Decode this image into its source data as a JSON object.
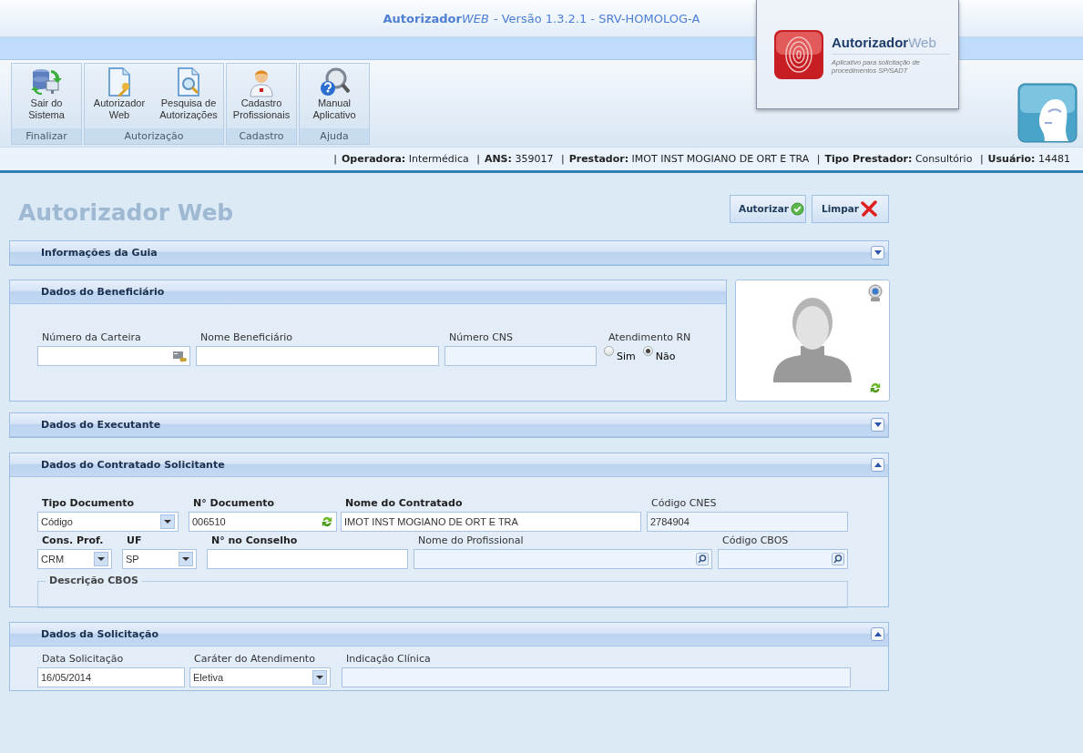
{
  "app_title": {
    "name": "Autorizador",
    "edition": "WEB",
    "version": "- Versão 1.3.2.1 - SRV-HOMOLOG-A"
  },
  "toolbar": [
    {
      "group": "Finalizar",
      "buttons": [
        {
          "label": "Sair do Sistema"
        }
      ]
    },
    {
      "group": "Autorização",
      "buttons": [
        {
          "label": "Autorizador Web"
        },
        {
          "label": "Pesquisa de Autorizações"
        }
      ]
    },
    {
      "group": "Cadastro",
      "buttons": [
        {
          "label": "Cadastro Profissionais"
        }
      ]
    },
    {
      "group": "Ajuda",
      "buttons": [
        {
          "label": "Manual Aplicativo"
        }
      ]
    }
  ],
  "splash": {
    "name": "Autorizador",
    "edition": "Web",
    "tagline": "Aplicativo para solicitação de procedimentos SP/SADT"
  },
  "info_bar": {
    "separator": "|",
    "items": [
      {
        "label": "Operadora:",
        "value": "Intermédica"
      },
      {
        "label": "ANS:",
        "value": "359017"
      },
      {
        "label": "Prestador:",
        "value": "IMOT INST MOGIANO DE ORT E TRA"
      },
      {
        "label": "Tipo Prestador:",
        "value": "Consultório"
      },
      {
        "label": "Usuário:",
        "value": "14481"
      }
    ]
  },
  "page_title": "Autorizador Web",
  "actions": [
    {
      "label": "Autorizar"
    },
    {
      "label": "Limpar"
    }
  ],
  "sections": [
    {
      "title": "Informações da Guia",
      "collapsible": true,
      "expanded": false
    },
    {
      "title": "Dados do Beneficiário",
      "collapsible": false,
      "photo_panel": true,
      "fields": [
        {
          "label": "Número da Carteira",
          "kind": "cardsearch",
          "disabled": false
        },
        {
          "label": "Nome Beneficiário",
          "kind": "text",
          "disabled": false
        },
        {
          "label": "Número CNS",
          "kind": "text",
          "disabled": true
        },
        {
          "label": "Atendimento RN",
          "kind": "radio",
          "options": [
            {
              "label": "Sim",
              "selected": false
            },
            {
              "label": "Não",
              "selected": true
            }
          ]
        }
      ]
    },
    {
      "title": "Dados do Executante",
      "collapsible": true,
      "expanded": false
    },
    {
      "title": "Dados do Contratado Solicitante",
      "collapsible": true,
      "expanded": true,
      "fields": [
        {
          "label": "Tipo Documento",
          "kind": "select",
          "value": "Código",
          "disabled": false,
          "bold_label": true
        },
        {
          "label": "N° Documento",
          "kind": "refresh",
          "value": "006510",
          "disabled": false,
          "bold_label": true
        },
        {
          "label": "Nome do Contratado",
          "kind": "text",
          "value": "IMOT INST MOGIANO DE ORT E TRA",
          "disabled": false,
          "bold_label": true
        },
        {
          "label": "Código CNES",
          "kind": "text",
          "value": "2784904",
          "disabled": true,
          "bold_label": false
        },
        {
          "label": "Cons. Prof.",
          "kind": "select",
          "value": "CRM",
          "disabled": false,
          "bold_label": true
        },
        {
          "label": "UF",
          "kind": "select",
          "value": "SP",
          "disabled": false,
          "bold_label": true
        },
        {
          "label": "N° no Conselho",
          "kind": "text",
          "disabled": false,
          "bold_label": true
        },
        {
          "label": "Nome do Profissional",
          "kind": "search",
          "disabled": true,
          "bold_label": false
        },
        {
          "label": "Código CBOS",
          "kind": "search",
          "disabled": true,
          "bold_label": false
        },
        {
          "label": "Descrição CBOS",
          "kind": "fieldset"
        }
      ]
    },
    {
      "title": "Dados da Solicitação",
      "collapsible": true,
      "expanded": true,
      "fields": [
        {
          "label": "Data Solicitação",
          "kind": "text",
          "value": "16/05/2014",
          "disabled": false
        },
        {
          "label": "Caráter do Atendimento",
          "kind": "select",
          "value": "Eletiva",
          "disabled": false
        },
        {
          "label": "Indicação Clínica",
          "kind": "text",
          "disabled": true
        }
      ]
    }
  ]
}
